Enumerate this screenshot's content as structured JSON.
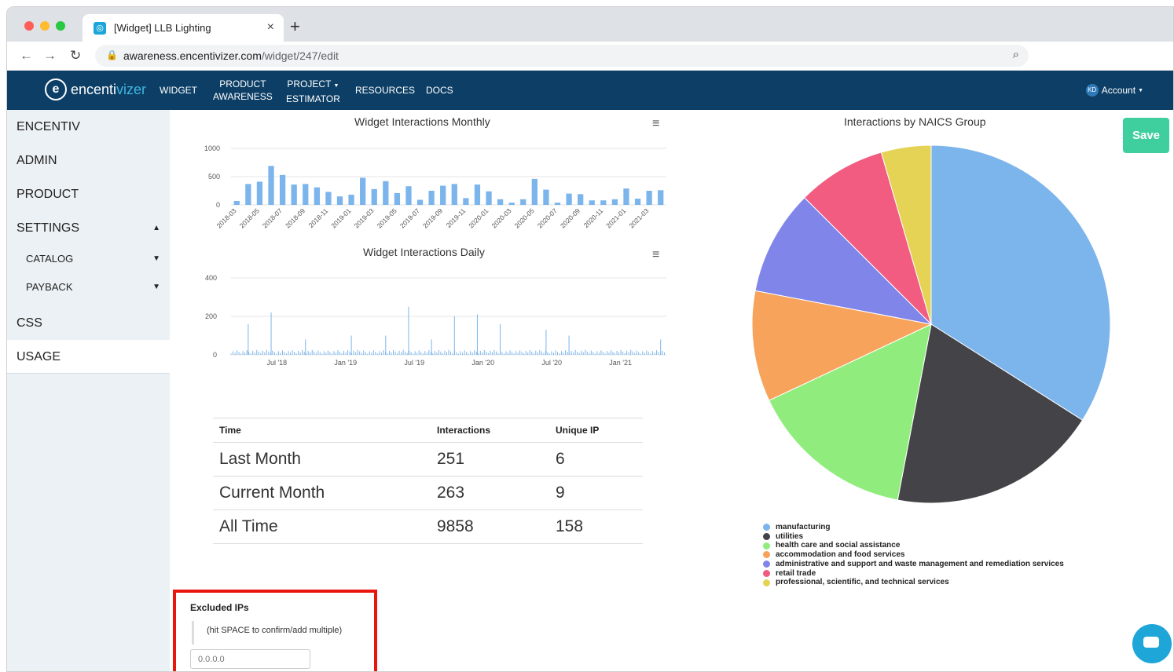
{
  "browser": {
    "tab_title": "[Widget] LLB Lighting",
    "tab_close": "×",
    "new_tab": "+",
    "url_host": "awareness.encentivizer.com",
    "url_path": "/widget/247/edit"
  },
  "nav": {
    "logo_a": "encenti",
    "logo_b": "vizer",
    "links": [
      "WIDGET",
      "PRODUCT",
      "AWARENESS",
      "PROJECT",
      "ESTIMATOR",
      "RESOURCES",
      "DOCS"
    ],
    "avatar_initials": "KD",
    "account": "Account"
  },
  "sidebar": {
    "items": [
      "ENCENTIV",
      "ADMIN",
      "PRODUCT",
      "SETTINGS",
      "CATALOG",
      "PAYBACK",
      "CSS",
      "USAGE"
    ]
  },
  "monthly": {
    "title": "Widget Interactions Monthly",
    "yticks": [
      "1000",
      "500",
      "0"
    ],
    "xticks": [
      "2018-03",
      "2018-05",
      "2018-07",
      "2018-09",
      "2018-11",
      "2019-01",
      "2019-03",
      "2019-05",
      "2019-07",
      "2019-09",
      "2019-11",
      "2020-01",
      "2020-03",
      "2020-05",
      "2020-07",
      "2020-09",
      "2020-11",
      "2021-01",
      "2021-03"
    ]
  },
  "daily": {
    "title": "Widget Interactions Daily",
    "yticks": [
      "400",
      "200",
      "0"
    ],
    "xticks": [
      "Jul '18",
      "Jan '19",
      "Jul '19",
      "Jan '20",
      "Jul '20",
      "Jan '21"
    ]
  },
  "chart_data": [
    {
      "type": "bar",
      "title": "Widget Interactions Monthly",
      "ylim": [
        0,
        1000
      ],
      "categories": [
        "2018-03",
        "2018-04",
        "2018-05",
        "2018-06",
        "2018-07",
        "2018-08",
        "2018-09",
        "2018-10",
        "2018-11",
        "2018-12",
        "2019-01",
        "2019-02",
        "2019-03",
        "2019-04",
        "2019-05",
        "2019-06",
        "2019-07",
        "2019-08",
        "2019-09",
        "2019-10",
        "2019-11",
        "2019-12",
        "2020-01",
        "2020-02",
        "2020-03",
        "2020-04",
        "2020-05",
        "2020-06",
        "2020-07",
        "2020-08",
        "2020-09",
        "2020-10",
        "2020-11",
        "2020-12",
        "2021-01",
        "2021-02",
        "2021-03",
        "2021-04"
      ],
      "values": [
        70,
        370,
        410,
        690,
        530,
        360,
        370,
        310,
        230,
        150,
        180,
        480,
        280,
        420,
        210,
        330,
        90,
        250,
        340,
        370,
        120,
        360,
        240,
        100,
        40,
        100,
        460,
        270,
        40,
        200,
        190,
        80,
        80,
        100,
        290,
        110,
        250,
        260
      ]
    },
    {
      "type": "bar",
      "title": "Widget Interactions Daily",
      "ylim": [
        0,
        400
      ],
      "x_range": [
        "2018-03",
        "2021-04"
      ],
      "spikes": [
        {
          "x": "2018-04",
          "y": 160
        },
        {
          "x": "2018-06",
          "y": 220
        },
        {
          "x": "2018-09",
          "y": 80
        },
        {
          "x": "2019-01",
          "y": 100
        },
        {
          "x": "2019-04",
          "y": 100
        },
        {
          "x": "2019-06",
          "y": 250
        },
        {
          "x": "2019-08",
          "y": 80
        },
        {
          "x": "2019-10",
          "y": 200
        },
        {
          "x": "2019-12",
          "y": 210
        },
        {
          "x": "2020-02",
          "y": 160
        },
        {
          "x": "2020-06",
          "y": 130
        },
        {
          "x": "2020-08",
          "y": 100
        },
        {
          "x": "2021-04",
          "y": 80
        }
      ]
    },
    {
      "type": "pie",
      "title": "Interactions by NAICS Group",
      "legend_position": "bottom",
      "series": [
        {
          "name": "manufacturing",
          "value": 34,
          "color": "#7cb5ec"
        },
        {
          "name": "utilities",
          "value": 19,
          "color": "#434348"
        },
        {
          "name": "health care and social assistance",
          "value": 15,
          "color": "#90ed7d"
        },
        {
          "name": "accommodation and food services",
          "value": 10,
          "color": "#f7a35c"
        },
        {
          "name": "administrative and support and waste management and remediation services",
          "value": 9.5,
          "color": "#8085e9"
        },
        {
          "name": "retail trade",
          "value": 8,
          "color": "#f15c80"
        },
        {
          "name": "professional, scientific, and technical services",
          "value": 4.5,
          "color": "#e4d354"
        }
      ]
    }
  ],
  "stats_table": {
    "headers": [
      "Time",
      "Interactions",
      "Unique IP"
    ],
    "rows": [
      [
        "Last Month",
        "251",
        "6"
      ],
      [
        "Current Month",
        "263",
        "9"
      ],
      [
        "All Time",
        "9858",
        "158"
      ]
    ]
  },
  "excluded_ips": {
    "label": "Excluded IPs",
    "hint": "(hit SPACE to confirm/add multiple)",
    "placeholder": "0.0.0.0"
  },
  "save_label": "Save",
  "pie_title": "Interactions by NAICS Group"
}
